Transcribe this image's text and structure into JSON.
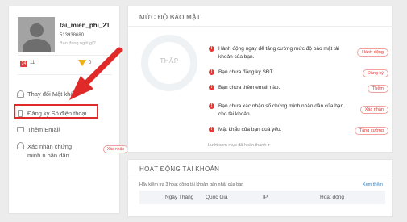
{
  "user": {
    "username": "tai_mien_phi_21",
    "id": "513938680",
    "hint": "Bạn đang ngồi gì?",
    "coins_red": "11",
    "coins_diamond": "0",
    "red_icon_text": "24"
  },
  "menu": {
    "change_password": "Thay đổi Mật khẩ",
    "register_phone": "Đăng ký Số điện thoại",
    "email": "Thêm Email",
    "verify": "Xác nhận chứng minh n hân dân",
    "verify_badge": "Xác nhận"
  },
  "security": {
    "title": "MỨC ĐỘ BẢO MẬT",
    "level": "THẤP",
    "items": [
      {
        "text": "Hành động ngay để tăng cường mức độ bảo mật tài khoản của bạn.",
        "button": "Hành động"
      },
      {
        "text": "Bạn chưa đăng ký SĐT.",
        "button": "Đăng ký"
      },
      {
        "text": "Bạn chưa thêm email nào.",
        "button": "Thêm"
      },
      {
        "text": "Bạn chưa xác nhận số chứng minh nhân dân của bạn cho tài khoản",
        "button": "Xác nhận"
      },
      {
        "text": "Mật khẩu của bạn quá yếu.",
        "button": "Tăng cường"
      }
    ],
    "more": "Lướt xem mục đã hoàn thành ▾"
  },
  "activity": {
    "title": "HOẠT ĐỘNG TÀI KHOẢN",
    "hint": "Hãy kiểm tra 3 hoạt động tài khoản gần nhất của bạn",
    "view_more": "Xem thêm",
    "columns": [
      "Ngày Tháng",
      "Quốc Gia",
      "IP",
      "Hoạt động"
    ]
  },
  "colors": {
    "accent_red": "#e53935",
    "highlight_box": "#e02a2a"
  }
}
